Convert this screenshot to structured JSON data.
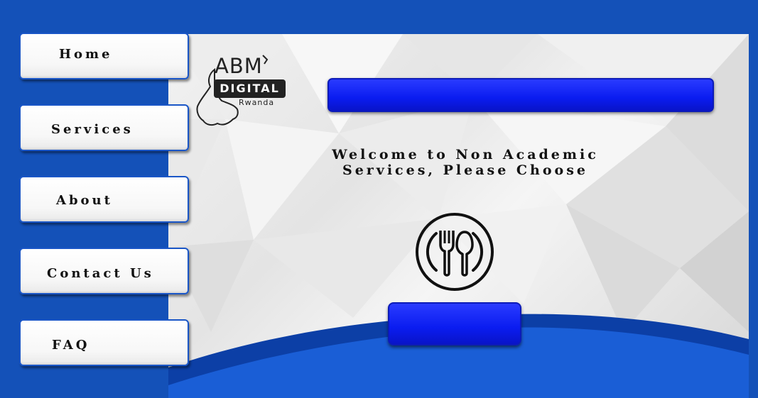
{
  "nav": {
    "items": [
      {
        "label": "Home"
      },
      {
        "label": "Services"
      },
      {
        "label": "About"
      },
      {
        "label": "Contact Us"
      },
      {
        "label": "FAQ"
      }
    ]
  },
  "logo": {
    "title": "ABM",
    "badge": "DIGITAL",
    "subtitle": "Rwanda"
  },
  "main": {
    "welcome_line1": "Welcome to Non Academic",
    "welcome_line2": "Services, Please Choose",
    "service_icon": "dining-plate-fork-spoon-icon"
  },
  "colors": {
    "background": "#1451b8",
    "accent_button": "#0a1cf0",
    "nav_border": "#1a56c7"
  }
}
